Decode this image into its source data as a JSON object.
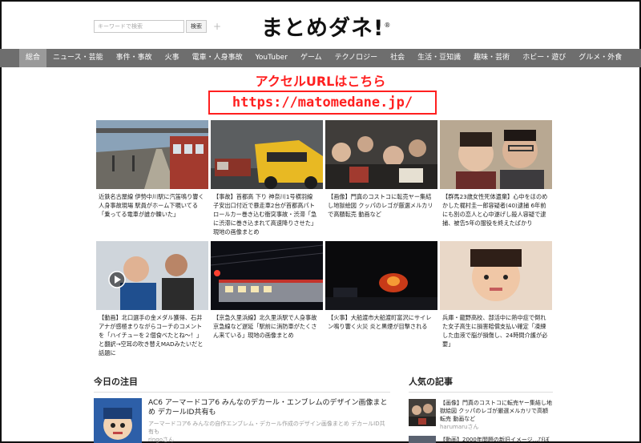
{
  "header": {
    "search_placeholder": "キーワードで検索",
    "search_button": "検索",
    "plus": "+",
    "logo": "まとめダネ!",
    "logo_mark": "®"
  },
  "nav": {
    "items": [
      "総合",
      "ニュース・芸能",
      "事件・事故",
      "火事",
      "電車・人身事故",
      "YouTuber",
      "ゲーム",
      "テクノロジー",
      "社会",
      "生活・豆知識",
      "趣味・芸術",
      "ホビー・遊び",
      "グルメ・外食"
    ],
    "active_index": 0
  },
  "promo": {
    "title": "アクセルURLはこちら",
    "url": "https://matomedane.jp/"
  },
  "cards": [
    "近鉄名古屋線 伊勢中川駅に汽笛鳴り響く人身事故現場 駅員がホーム下覗いてる「乗ってる電車が誰か轢いた」",
    "【事故】首都高 下り 神奈川1号横羽線 子安出口付近で暴走車2台が首都高パトロールカー巻き込む衝突事故・渋滞「急に渋滞に巻き込まれて高速降りさせた」現地の画像まとめ",
    "【画像】門真のコストコに転売ヤー集結し地獄絵図 クッパのレゴが厳選メルカリで高額転売 動画など",
    "【群馬23歳女性死体遺棄】心中をほのめかした梶村圭一郎容疑者(40)逮捕 6年前にも別の恋人と心中遂げし殺人容疑で逮捕、被告5年の服役を終えたばかり",
    "【動画】北口選手の金メダル獲得、石井アナが感極まりながらコーチのコメントを「ハイチューを２個食べたとね～！」と翻訳→空耳の吹き替えMADみたいだと話題に",
    "【京急久里浜線】北久里浜駅で人身事故 京急線など遅延「駅前に消防車がたくさん来ている」現地の画像まとめ",
    "【火事】大船渡市大船渡町富沢にサイレン鳴り響く火災 炎と黒煙が目撃される",
    "兵庫・龍野高校、部活中に熱中症で倒れた女子高生に損害賠償支払い確定「凍練した血液で脳が損傷し、24時間介護が必要」"
  ],
  "today": {
    "section_title": "今日の注目",
    "title": "AC6 アーマードコア6 みんなのデカール・エンブレムのデザイン画像まとめ デカールID共有も",
    "desc": "アーマードコア6 みんなの自作エンブレム・デカール作成のデザイン画像まとめ デカールID共有も",
    "author": "ringoさん"
  },
  "popular": {
    "section_title": "人気の記事",
    "item1_title": "【画像】門真のコストコに転売ヤー集結し地獄絵図 クッパのレゴが厳選メルカリで高額転売 動画など",
    "item1_author": "harumaruさん",
    "item2_title": "【動画】2000年問題の新旧イメージ…びぼ"
  },
  "colors": {
    "nav_bg": "#6e6e6e",
    "accent_red": "#ff1f1f"
  }
}
